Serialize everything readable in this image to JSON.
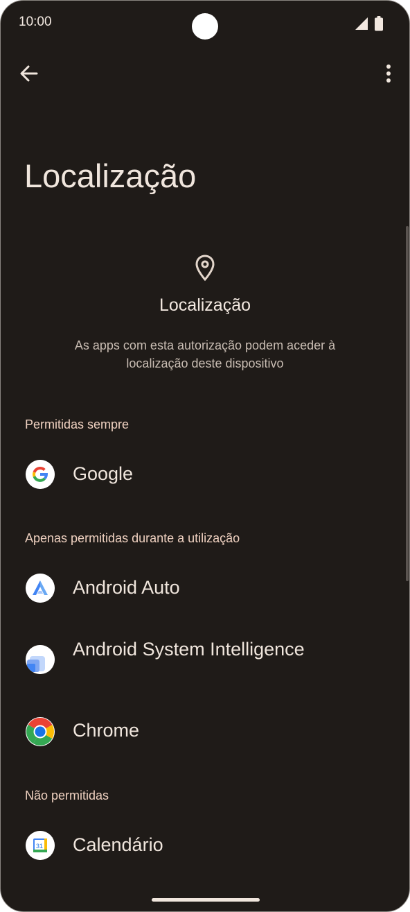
{
  "status_bar": {
    "time": "10:00"
  },
  "page": {
    "title": "Localização"
  },
  "header": {
    "title": "Localização",
    "description_line1": "As apps com esta autorização podem aceder à",
    "description_line2": "localização deste dispositivo"
  },
  "sections": {
    "always": {
      "label": "Permitidas sempre"
    },
    "while_in_use": {
      "label": "Apenas permitidas durante a utilização"
    },
    "denied": {
      "label": "Não permitidas"
    }
  },
  "apps": {
    "google": {
      "label": "Google",
      "icon": "google-icon"
    },
    "android_auto": {
      "label": "Android Auto",
      "icon": "android-auto-icon"
    },
    "asi": {
      "label": "Android System Intelligence",
      "icon": "android-system-intelligence-icon"
    },
    "chrome": {
      "label": "Chrome",
      "icon": "chrome-icon"
    },
    "calendar": {
      "label": "Calendário",
      "icon": "calendar-icon",
      "icon_text": "31"
    }
  },
  "colors": {
    "background": "#1f1b18",
    "text_primary": "#f0e6dd",
    "text_secondary": "#c9bdb3",
    "section_accent": "#efd1c0"
  }
}
